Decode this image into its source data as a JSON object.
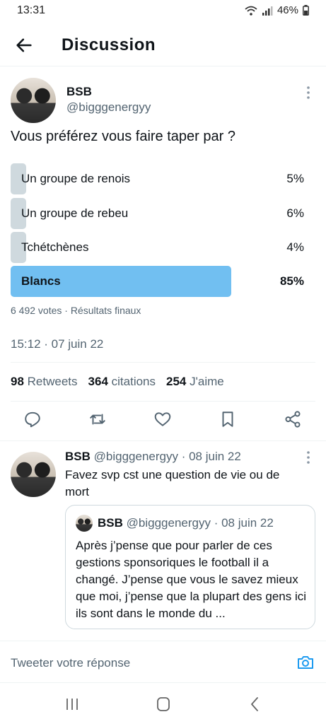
{
  "status_bar": {
    "time": "13:31",
    "battery": "46%",
    "icons": [
      "wifi-icon",
      "signal-icon",
      "battery-icon"
    ]
  },
  "header": {
    "title": "Discussion",
    "back_icon": "back-arrow-icon"
  },
  "tweet": {
    "author_name": "BSB",
    "author_handle": "@bigggenergyy",
    "text": "Vous préférez vous faire taper par ?",
    "poll": {
      "options": [
        {
          "label": "Un groupe de renois",
          "percent_text": "5%",
          "percent": 5,
          "winner": false
        },
        {
          "label": "Un groupe de rebeu",
          "percent_text": "6%",
          "percent": 6,
          "winner": false
        },
        {
          "label": "Tchétchènes",
          "percent_text": "4%",
          "percent": 4,
          "winner": false
        },
        {
          "label": "Blancs",
          "percent_text": "85%",
          "percent": 85,
          "winner": true
        }
      ],
      "meta": "6 492 votes · Résultats finaux"
    },
    "timestamp": "15:12 · 07 juin 22",
    "stats": {
      "retweets_count": "98",
      "retweets_label": "Retweets",
      "quotes_count": "364",
      "quotes_label": "citations",
      "likes_count": "254",
      "likes_label": "J'aime"
    }
  },
  "reply": {
    "author_name": "BSB",
    "meta": "@bigggenergyy · 08 juin 22",
    "text": "Favez svp cst une question de vie ou de mort",
    "quote": {
      "author_name": "BSB",
      "meta": "@bigggenergyy · 08 juin 22",
      "text": "Après j’pense que pour parler de ces gestions sponsoriques le football il a changé. J’pense que vous le savez mieux que moi, j’pense que la plupart des gens ici ils sont dans le monde du ..."
    }
  },
  "composer": {
    "placeholder": "Tweeter votre réponse"
  },
  "colors": {
    "accent": "#1d9bf0",
    "poll_winner": "#71bff1",
    "poll_other": "#cfd9de",
    "secondary_text": "#536471"
  }
}
